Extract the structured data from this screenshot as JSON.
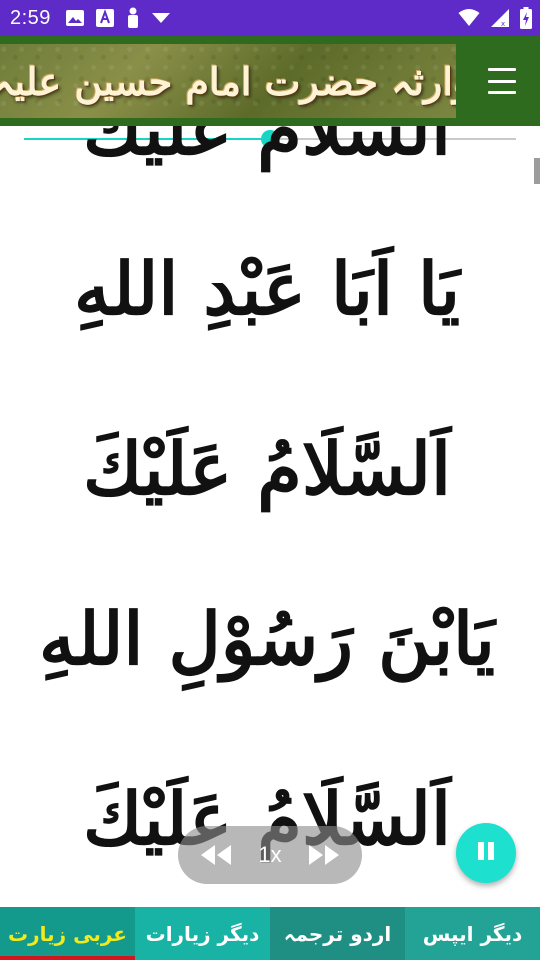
{
  "status_bar": {
    "time": "2:59",
    "left_icons": [
      "image-icon",
      "font-a-icon",
      "person-icon",
      "dropdown-arrow-icon"
    ],
    "right_icons": [
      "wifi-icon",
      "signal-icon",
      "battery-icon"
    ]
  },
  "app_bar": {
    "banner_text": "زیارت وارثہ حضرت امام حسین علیہ السلام",
    "menu_icon": "hamburger-menu-icon"
  },
  "player": {
    "progress_percent": 50,
    "speed_label": "1x",
    "rewind_icon": "rewind-icon",
    "forward_icon": "fast-forward-icon",
    "fab_icon": "pause-icon"
  },
  "verses": [
    "اَلسَّلَامُ عَلَيْكَ",
    "يَا اَبَا عَبْدِ اللهِ",
    "اَلسَّلَامُ عَلَيْكَ",
    "يَابْنَ رَسُوْلِ اللهِ",
    "اَلسَّلَامُ عَلَيْكَ"
  ],
  "bottom_nav": {
    "tabs": [
      {
        "label": "عربی زیارت",
        "active": true
      },
      {
        "label": "دیگر زیارات",
        "active": false
      },
      {
        "label": "اردو ترجمہ",
        "active": false
      },
      {
        "label": "دیگر ایپس",
        "active": false
      }
    ]
  },
  "colors": {
    "status_bar": "#5e2bc8",
    "app_bar": "#2e6b1f",
    "accent": "#19d6c4",
    "active_tab_text": "#f2ea1c",
    "active_indicator": "#d2161e"
  }
}
